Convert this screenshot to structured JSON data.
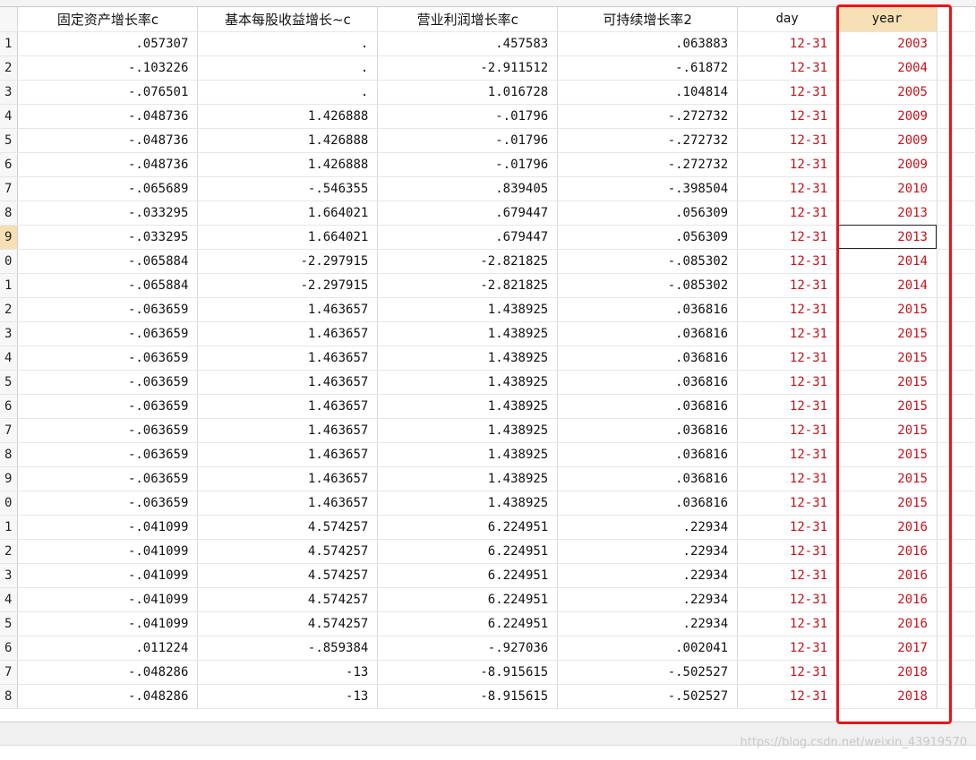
{
  "columns": {
    "c1": "固定资产增长率c",
    "c2": "基本每股收益增长~c",
    "c3": "营业利润增长率c",
    "c4": "可持续增长率2",
    "c5": "day",
    "c6": "year"
  },
  "rows": [
    {
      "n": "1",
      "c1": ".057307",
      "c2": ".",
      "c3": ".457583",
      "c4": ".063883",
      "c5": "12-31",
      "c6": "2003"
    },
    {
      "n": "2",
      "c1": "-.103226",
      "c2": ".",
      "c3": "-2.911512",
      "c4": "-.61872",
      "c5": "12-31",
      "c6": "2004"
    },
    {
      "n": "3",
      "c1": "-.076501",
      "c2": ".",
      "c3": "1.016728",
      "c4": ".104814",
      "c5": "12-31",
      "c6": "2005"
    },
    {
      "n": "4",
      "c1": "-.048736",
      "c2": "1.426888",
      "c3": "-.01796",
      "c4": "-.272732",
      "c5": "12-31",
      "c6": "2009"
    },
    {
      "n": "5",
      "c1": "-.048736",
      "c2": "1.426888",
      "c3": "-.01796",
      "c4": "-.272732",
      "c5": "12-31",
      "c6": "2009"
    },
    {
      "n": "6",
      "c1": "-.048736",
      "c2": "1.426888",
      "c3": "-.01796",
      "c4": "-.272732",
      "c5": "12-31",
      "c6": "2009"
    },
    {
      "n": "7",
      "c1": "-.065689",
      "c2": "-.546355",
      "c3": ".839405",
      "c4": "-.398504",
      "c5": "12-31",
      "c6": "2010"
    },
    {
      "n": "8",
      "c1": "-.033295",
      "c2": "1.664021",
      "c3": ".679447",
      "c4": ".056309",
      "c5": "12-31",
      "c6": "2013"
    },
    {
      "n": "9",
      "c1": "-.033295",
      "c2": "1.664021",
      "c3": ".679447",
      "c4": ".056309",
      "c5": "12-31",
      "c6": "2013"
    },
    {
      "n": "0",
      "c1": "-.065884",
      "c2": "-2.297915",
      "c3": "-2.821825",
      "c4": "-.085302",
      "c5": "12-31",
      "c6": "2014"
    },
    {
      "n": "1",
      "c1": "-.065884",
      "c2": "-2.297915",
      "c3": "-2.821825",
      "c4": "-.085302",
      "c5": "12-31",
      "c6": "2014"
    },
    {
      "n": "2",
      "c1": "-.063659",
      "c2": "1.463657",
      "c3": "1.438925",
      "c4": ".036816",
      "c5": "12-31",
      "c6": "2015"
    },
    {
      "n": "3",
      "c1": "-.063659",
      "c2": "1.463657",
      "c3": "1.438925",
      "c4": ".036816",
      "c5": "12-31",
      "c6": "2015"
    },
    {
      "n": "4",
      "c1": "-.063659",
      "c2": "1.463657",
      "c3": "1.438925",
      "c4": ".036816",
      "c5": "12-31",
      "c6": "2015"
    },
    {
      "n": "5",
      "c1": "-.063659",
      "c2": "1.463657",
      "c3": "1.438925",
      "c4": ".036816",
      "c5": "12-31",
      "c6": "2015"
    },
    {
      "n": "6",
      "c1": "-.063659",
      "c2": "1.463657",
      "c3": "1.438925",
      "c4": ".036816",
      "c5": "12-31",
      "c6": "2015"
    },
    {
      "n": "7",
      "c1": "-.063659",
      "c2": "1.463657",
      "c3": "1.438925",
      "c4": ".036816",
      "c5": "12-31",
      "c6": "2015"
    },
    {
      "n": "8",
      "c1": "-.063659",
      "c2": "1.463657",
      "c3": "1.438925",
      "c4": ".036816",
      "c5": "12-31",
      "c6": "2015"
    },
    {
      "n": "9",
      "c1": "-.063659",
      "c2": "1.463657",
      "c3": "1.438925",
      "c4": ".036816",
      "c5": "12-31",
      "c6": "2015"
    },
    {
      "n": "0",
      "c1": "-.063659",
      "c2": "1.463657",
      "c3": "1.438925",
      "c4": ".036816",
      "c5": "12-31",
      "c6": "2015"
    },
    {
      "n": "1",
      "c1": "-.041099",
      "c2": "4.574257",
      "c3": "6.224951",
      "c4": ".22934",
      "c5": "12-31",
      "c6": "2016"
    },
    {
      "n": "2",
      "c1": "-.041099",
      "c2": "4.574257",
      "c3": "6.224951",
      "c4": ".22934",
      "c5": "12-31",
      "c6": "2016"
    },
    {
      "n": "3",
      "c1": "-.041099",
      "c2": "4.574257",
      "c3": "6.224951",
      "c4": ".22934",
      "c5": "12-31",
      "c6": "2016"
    },
    {
      "n": "4",
      "c1": "-.041099",
      "c2": "4.574257",
      "c3": "6.224951",
      "c4": ".22934",
      "c5": "12-31",
      "c6": "2016"
    },
    {
      "n": "5",
      "c1": "-.041099",
      "c2": "4.574257",
      "c3": "6.224951",
      "c4": ".22934",
      "c5": "12-31",
      "c6": "2016"
    },
    {
      "n": "6",
      "c1": ".011224",
      "c2": "-.859384",
      "c3": "-.927036",
      "c4": ".002041",
      "c5": "12-31",
      "c6": "2017"
    },
    {
      "n": "7",
      "c1": "-.048286",
      "c2": "-13",
      "c3": "-8.915615",
      "c4": "-.502527",
      "c5": "12-31",
      "c6": "2018"
    },
    {
      "n": "8",
      "c1": "-.048286",
      "c2": "-13",
      "c3": "-8.915615",
      "c4": "-.502527",
      "c5": "12-31",
      "c6": "2018"
    }
  ],
  "selected_row_label": "9",
  "watermark": "https://blog.csdn.net/weixin_43919570",
  "colors": {
    "highlight_box": "#e8141c",
    "string_value": "#c0141c",
    "selected_header": "#f6dfb4"
  }
}
